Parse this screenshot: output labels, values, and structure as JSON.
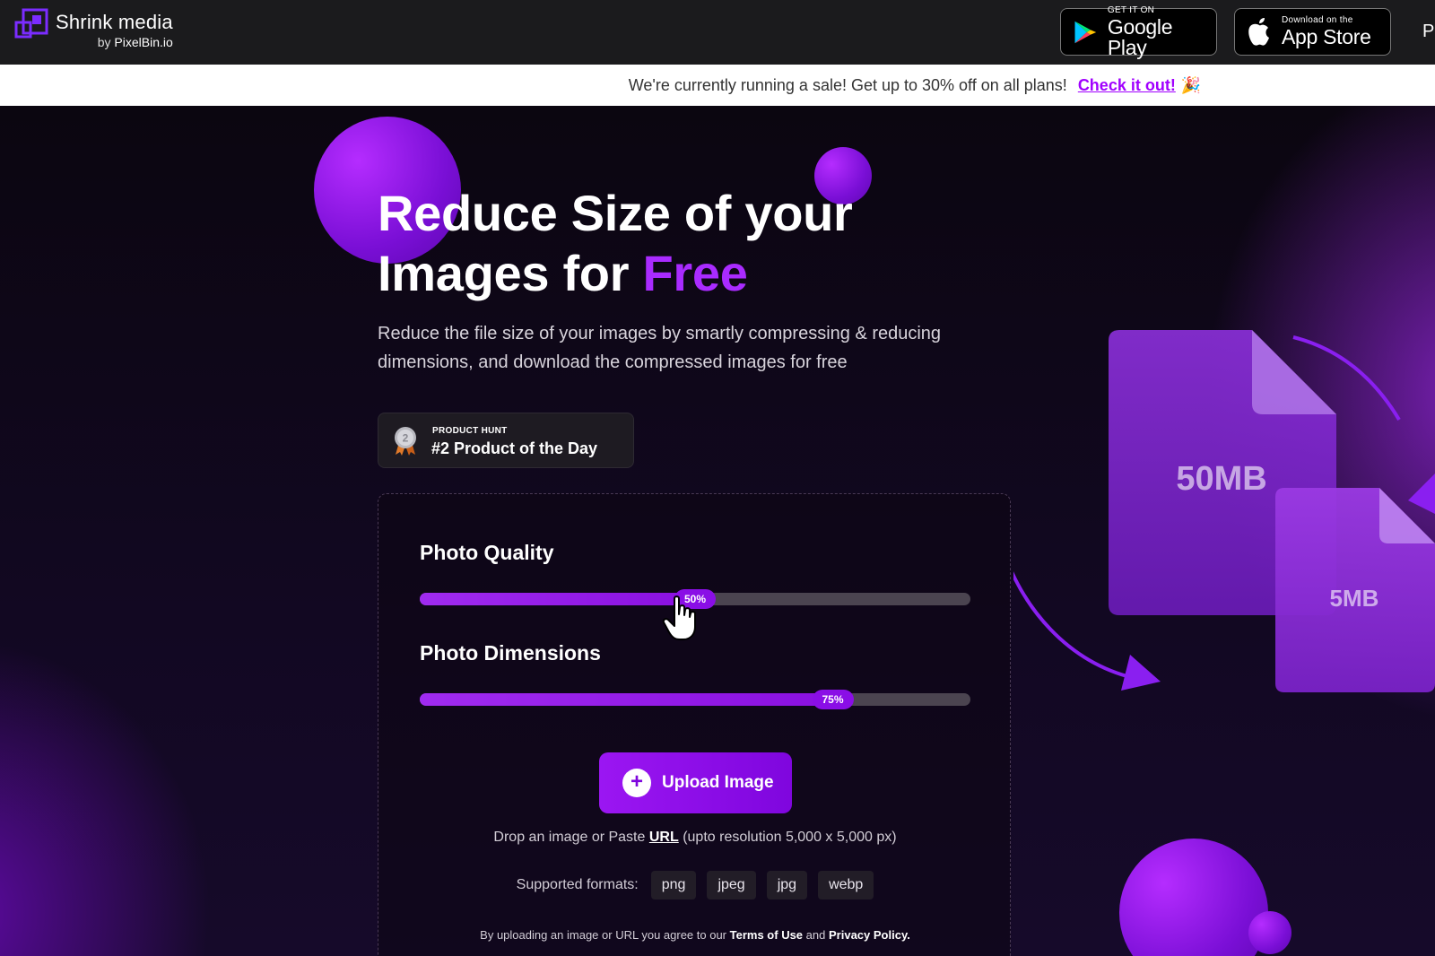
{
  "header": {
    "logo_title": "Shrink media",
    "logo_by": "by",
    "logo_brand": "PixelBin.io",
    "google_play_small": "GET IT ON",
    "google_play_big": "Google Play",
    "app_store_small": "Download on the",
    "app_store_big": "App Store",
    "nav_cut": "P"
  },
  "sale_banner": {
    "text": "We're currently running a sale! Get up to 30% off on all plans!",
    "link": "Check it out!",
    "emoji": "🎉"
  },
  "hero": {
    "title_line1": "Reduce Size of your",
    "title_line2_prefix": "Images for ",
    "title_highlight": "Free",
    "lead": "Reduce the file size of your images by smartly compressing & reducing dimensions, and download the compressed images for free"
  },
  "product_hunt": {
    "label": "PRODUCT HUNT",
    "title": "#2 Product of the Day",
    "rank": "2"
  },
  "controls": {
    "quality_label": "Photo Quality",
    "quality_value": 50,
    "quality_text": "50%",
    "dimensions_label": "Photo Dimensions",
    "dimensions_value": 75,
    "dimensions_text": "75%"
  },
  "upload": {
    "button_label": "Upload Image",
    "drop_prefix": "Drop an image or Paste",
    "drop_url": "URL",
    "drop_suffix": "(upto resolution 5,000 x 5,000 px)",
    "formats_label": "Supported formats:",
    "formats": [
      "png",
      "jpeg",
      "jpg",
      "webp"
    ],
    "terms_prefix": "By uploading an image or URL you agree to our",
    "terms_link": "Terms of Use",
    "terms_and": "and",
    "privacy_link": "Privacy Policy."
  },
  "illustration": {
    "big_file": "50MB",
    "small_file": "5MB"
  },
  "colors": {
    "accent": "#a100ff",
    "topbar": "#1b1b1d",
    "highlight": "#a92bff"
  }
}
